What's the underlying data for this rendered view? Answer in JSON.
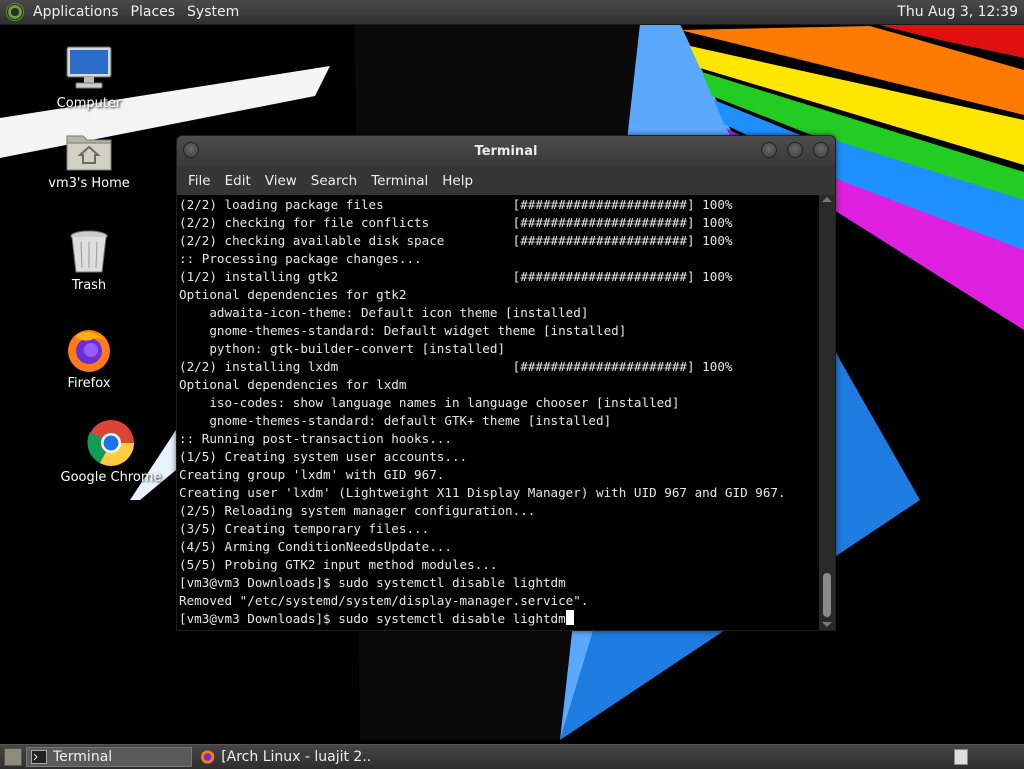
{
  "top_panel": {
    "menus": [
      "Applications",
      "Places",
      "System"
    ],
    "clock": "Thu Aug  3, 12:39"
  },
  "desktop_icons": [
    {
      "label": "Computer",
      "icon": "computer-icon"
    },
    {
      "label": "vm3's Home",
      "icon": "home-folder-icon"
    },
    {
      "label": "Trash",
      "icon": "trash-icon"
    },
    {
      "label": "Firefox",
      "icon": "firefox-icon"
    },
    {
      "label": "Google Chrome",
      "icon": "chrome-icon"
    }
  ],
  "terminal": {
    "title": "Terminal",
    "menu": [
      "File",
      "Edit",
      "View",
      "Search",
      "Terminal",
      "Help"
    ],
    "lines": [
      "(2/2) loading package files                 [######################] 100%",
      "(2/2) checking for file conflicts           [######################] 100%",
      "(2/2) checking available disk space         [######################] 100%",
      ":: Processing package changes...",
      "(1/2) installing gtk2                       [######################] 100%",
      "Optional dependencies for gtk2",
      "    adwaita-icon-theme: Default icon theme [installed]",
      "    gnome-themes-standard: Default widget theme [installed]",
      "    python: gtk-builder-convert [installed]",
      "(2/2) installing lxdm                       [######################] 100%",
      "Optional dependencies for lxdm",
      "    iso-codes: show language names in language chooser [installed]",
      "    gnome-themes-standard: default GTK+ theme [installed]",
      ":: Running post-transaction hooks...",
      "(1/5) Creating system user accounts...",
      "Creating group 'lxdm' with GID 967.",
      "Creating user 'lxdm' (Lightweight X11 Display Manager) with UID 967 and GID 967.",
      "(2/5) Reloading system manager configuration...",
      "(3/5) Creating temporary files...",
      "(4/5) Arming ConditionNeedsUpdate...",
      "(5/5) Probing GTK2 input method modules...",
      "[vm3@vm3 Downloads]$ sudo systemctl disable lightdm",
      "Removed \"/etc/systemd/system/display-manager.service\"."
    ],
    "prompt_line": "[vm3@vm3 Downloads]$ sudo systemctl disable lightdm"
  },
  "taskbar": {
    "items": [
      {
        "label": "Terminal",
        "icon": "terminal-icon",
        "active": true
      },
      {
        "label": "[Arch Linux - luajit 2....",
        "icon": "firefox-icon",
        "active": false
      }
    ]
  }
}
